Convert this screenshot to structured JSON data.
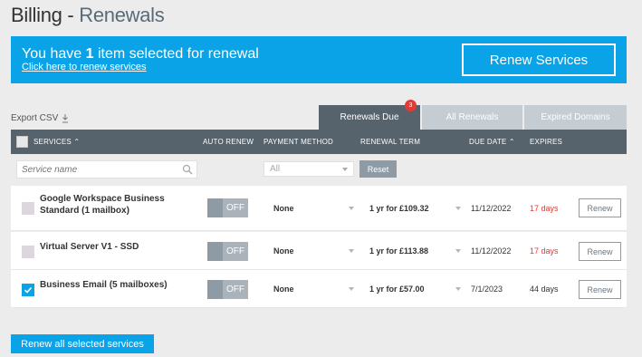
{
  "page": {
    "title": "Billing",
    "separator": " - ",
    "subtitle": "Renewals"
  },
  "banner": {
    "msg_pre": "You have ",
    "count": "1",
    "msg_post": " item selected for renewal",
    "link": "Click here to renew services",
    "button": "Renew Services"
  },
  "export": {
    "label": "Export CSV"
  },
  "tabs": [
    {
      "label": "Renewals Due",
      "badge": "3",
      "active": true
    },
    {
      "label": "All Renewals"
    },
    {
      "label": "Expired Domains"
    }
  ],
  "table": {
    "headers": {
      "services": "SERVICES ⌃",
      "auto_renew": "AUTO RENEW",
      "payment_method": "PAYMENT METHOD",
      "renewal_term": "RENEWAL TERM",
      "due_date": "DUE DATE ⌃",
      "expires": "EXPIRES"
    },
    "filters": {
      "search_placeholder": "Service name",
      "payment_all": "All",
      "reset": "Reset"
    },
    "rows": [
      {
        "service": "Google Workspace Business Standard (1 mailbox)",
        "auto_renew": "OFF",
        "payment": "None",
        "term": "1 yr for £109.32",
        "due": "11/12/2022",
        "expires": "17 days",
        "checked": false,
        "action": "Renew"
      },
      {
        "service": "Virtual Server V1 - SSD",
        "auto_renew": "OFF",
        "payment": "None",
        "term": "1 yr for £113.88",
        "due": "11/12/2022",
        "expires": "17 days",
        "checked": false,
        "action": "Renew"
      },
      {
        "service": "Business Email (5 mailboxes)",
        "auto_renew": "OFF",
        "payment": "None",
        "term": "1 yr for £57.00",
        "due": "7/1/2023",
        "expires": "44 days",
        "checked": true,
        "action": "Renew"
      }
    ]
  },
  "footer": {
    "renew_all": "Renew all selected services"
  },
  "colors": {
    "accent": "#0ba3e7",
    "header": "#56626c",
    "warn": "#e53935"
  }
}
